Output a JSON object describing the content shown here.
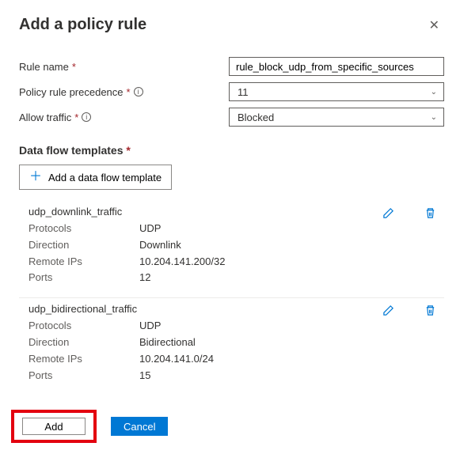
{
  "header": {
    "title": "Add a policy rule"
  },
  "form": {
    "ruleName": {
      "label": "Rule name",
      "value": "rule_block_udp_from_specific_sources"
    },
    "precedence": {
      "label": "Policy rule precedence",
      "value": "11"
    },
    "allowTraffic": {
      "label": "Allow traffic",
      "value": "Blocked"
    }
  },
  "dataFlow": {
    "sectionTitle": "Data flow templates",
    "addButton": "Add a data flow template",
    "labels": {
      "protocols": "Protocols",
      "direction": "Direction",
      "remoteIps": "Remote IPs",
      "ports": "Ports"
    },
    "items": [
      {
        "name": "udp_downlink_traffic",
        "protocols": "UDP",
        "direction": "Downlink",
        "remoteIps": "10.204.141.200/32",
        "ports": "12"
      },
      {
        "name": "udp_bidirectional_traffic",
        "protocols": "UDP",
        "direction": "Bidirectional",
        "remoteIps": "10.204.141.0/24",
        "ports": "15"
      }
    ]
  },
  "footer": {
    "add": "Add",
    "cancel": "Cancel"
  }
}
